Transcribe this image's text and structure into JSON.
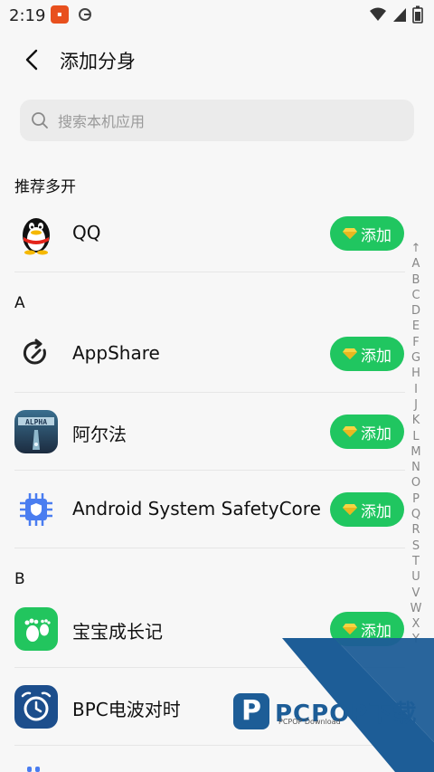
{
  "status": {
    "time": "2:19"
  },
  "header": {
    "title": "添加分身"
  },
  "search": {
    "placeholder": "搜索本机应用"
  },
  "sections": {
    "recommended": "推荐多开",
    "a": "A",
    "b": "B"
  },
  "apps": [
    {
      "name": "QQ",
      "add": "添加",
      "icon": "qq-penguin-icon"
    },
    {
      "name": "AppShare",
      "add": "添加",
      "icon": "appshare-icon"
    },
    {
      "name": "阿尔法",
      "add": "添加",
      "icon": "alpha-game-icon"
    },
    {
      "name": "Android System SafetyCore",
      "add": "添加",
      "icon": "safetycore-chip-icon"
    },
    {
      "name": "宝宝成长记",
      "add": "添加",
      "icon": "baby-footprint-icon"
    },
    {
      "name": "BPC电波对时",
      "add": "添加",
      "icon": "bpc-clock-icon"
    }
  ],
  "index_letters": [
    "↑",
    "A",
    "B",
    "C",
    "D",
    "E",
    "F",
    "G",
    "H",
    "I",
    "J",
    "K",
    "L",
    "M",
    "N",
    "O",
    "P",
    "Q",
    "R",
    "S",
    "T",
    "U",
    "V",
    "W",
    "X",
    "Y"
  ],
  "watermark": {
    "brand": "PCPOP下载",
    "sub": "PCPOP Download"
  },
  "colors": {
    "accent": "#20c660",
    "watermark": "#1d5d97"
  }
}
